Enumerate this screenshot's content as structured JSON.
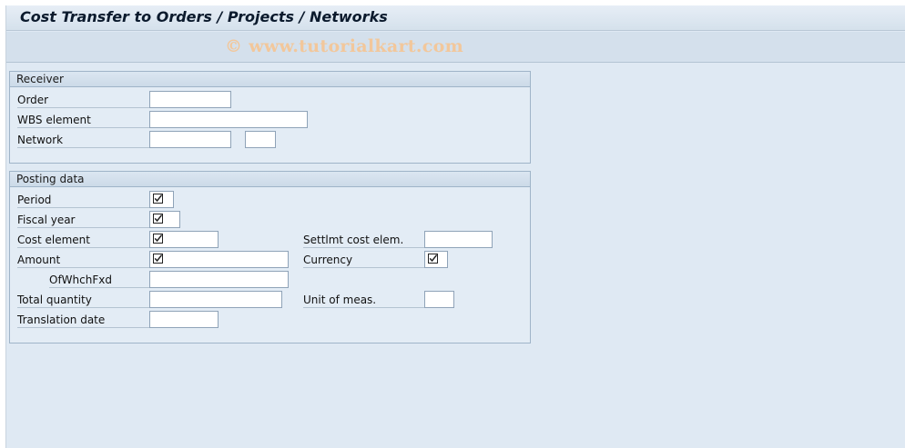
{
  "window": {
    "title": "Cost Transfer to Orders / Projects / Networks"
  },
  "watermark": "© www.tutorialkart.com",
  "receiver": {
    "title": "Receiver",
    "order_label": "Order",
    "order_value": "",
    "wbs_label": "WBS element",
    "wbs_value": "",
    "network_label": "Network",
    "network_value": "",
    "activity_value": ""
  },
  "posting": {
    "title": "Posting data",
    "period_label": "Period",
    "fiscal_year_label": "Fiscal year",
    "cost_element_label": "Cost element",
    "amount_label": "Amount",
    "of_which_fixed_label": "OfWhchFxd",
    "total_quantity_label": "Total quantity",
    "translation_date_label": "Translation date",
    "settlement_cost_elem_label": "Settlmt cost elem.",
    "currency_label": "Currency",
    "unit_label": "Unit of meas."
  },
  "icons": {
    "required": "required-checkbox-icon"
  }
}
